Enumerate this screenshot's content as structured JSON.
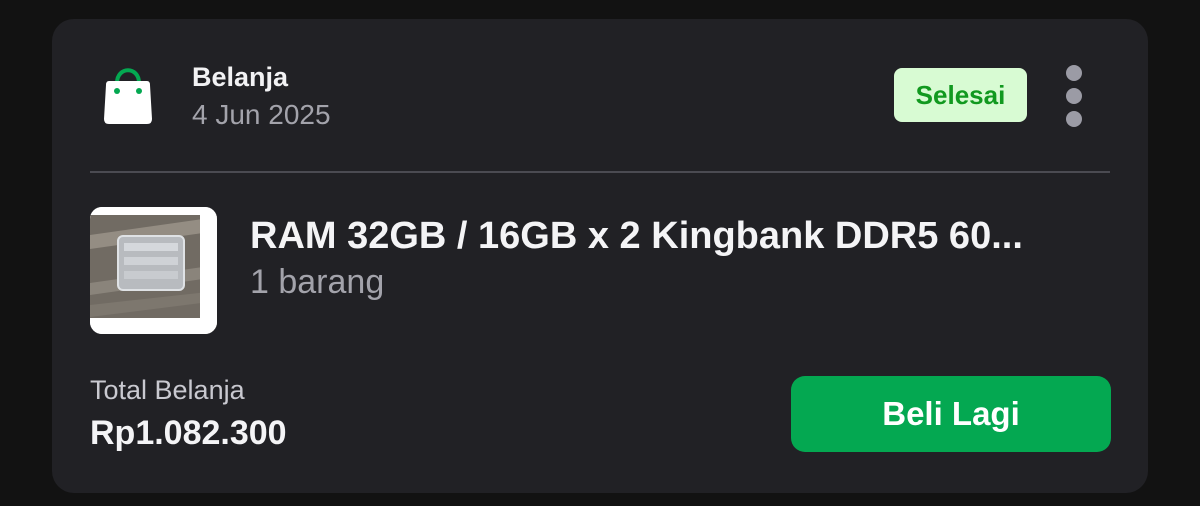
{
  "order": {
    "category": "Belanja",
    "date": "4 Jun 2025",
    "status": "Selesai",
    "product_name": "RAM 32GB / 16GB x 2 Kingbank DDR5 60...",
    "quantity": "1 barang",
    "total_label": "Total Belanja",
    "total_value": "Rp1.082.300",
    "buy_again_label": "Beli Lagi",
    "category_icon": "shopping-bag-icon",
    "more_icon": "more-vertical-icon"
  },
  "colors": {
    "background": "#121212",
    "card": "#212125",
    "accent_green": "#04a851",
    "status_bg": "#d8fbd3",
    "status_text": "#11991f"
  }
}
